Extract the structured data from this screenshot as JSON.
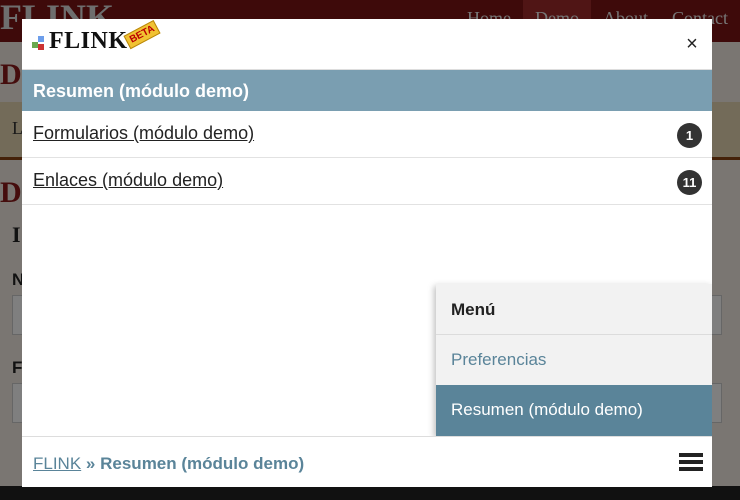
{
  "background": {
    "logo": "FLINK",
    "nav": [
      "Home",
      "Demo",
      "About",
      "Contact"
    ],
    "heading_1": "D",
    "heading_2": "D",
    "heading_3": "I",
    "band_letter": "L",
    "field_label_1": "N",
    "field_label_2": "F"
  },
  "modal": {
    "brand": {
      "name": "FLINK",
      "beta": "BETA"
    },
    "close_label": "×",
    "section_title": "Resumen (módulo demo)",
    "items": [
      {
        "label": "Formularios (módulo demo)",
        "count": "1"
      },
      {
        "label": "Enlaces (módulo demo)",
        "count": "11"
      }
    ],
    "menu": {
      "title": "Menú",
      "items": [
        {
          "label": "Preferencias"
        },
        {
          "label": "Resumen (módulo demo)"
        }
      ]
    },
    "footer": {
      "root": "FLINK",
      "separator": "»",
      "current": "Resumen (módulo demo)"
    }
  },
  "colors": {
    "section_bar": "#7a9eb1",
    "accent": "#5a8499",
    "badge": "#333333",
    "nav_bg": "#7d1414"
  }
}
